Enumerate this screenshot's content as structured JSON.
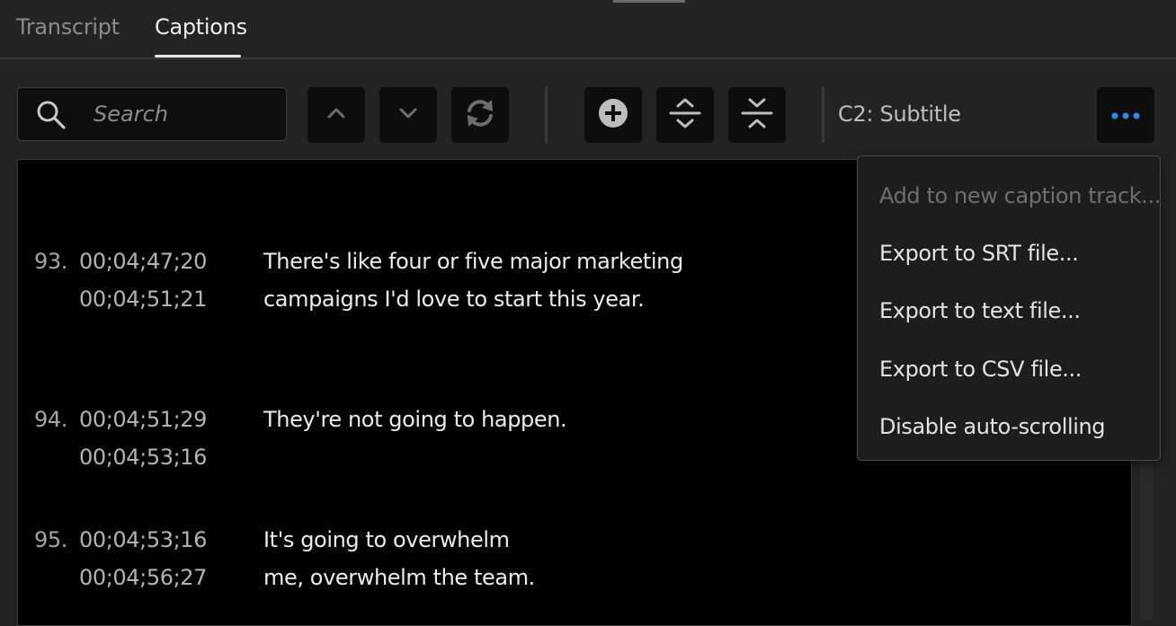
{
  "tabs": [
    {
      "label": "Transcript",
      "active": false
    },
    {
      "label": "Captions",
      "active": true
    }
  ],
  "toolbar": {
    "search_placeholder": "Search",
    "search_value": "",
    "track_label": "C2: Subtitle",
    "icons": {
      "up": "chevron-up-icon",
      "down": "chevron-down-icon",
      "refresh": "refresh-icon",
      "add": "add-circle-icon",
      "split": "split-caption-icon",
      "merge": "merge-captions-icon",
      "more": "more-options-icon"
    },
    "accent_color": "#2d8ceb"
  },
  "captions": [
    {
      "number": "93.",
      "start": "00;04;47;20",
      "end": "00;04;51;21",
      "line1": "There's like four or five major marketing",
      "line2": "campaigns I'd love to start this year."
    },
    {
      "number": "94.",
      "start": "00;04;51;29",
      "end": "00;04;53;16",
      "line1": "They're not going to happen.",
      "line2": ""
    },
    {
      "number": "95.",
      "start": "00;04;53;16",
      "end": "00;04;56;27",
      "line1": "It's going to overwhelm",
      "line2": "me, overwhelm the team."
    }
  ],
  "menu": {
    "items": [
      {
        "label": "Add to new caption track...",
        "disabled": true
      },
      {
        "label": "Export to SRT file...",
        "disabled": false
      },
      {
        "label": "Export to text file...",
        "disabled": false
      },
      {
        "label": "Export to CSV file...",
        "disabled": false
      },
      {
        "label": "Disable auto-scrolling",
        "disabled": false
      }
    ]
  }
}
